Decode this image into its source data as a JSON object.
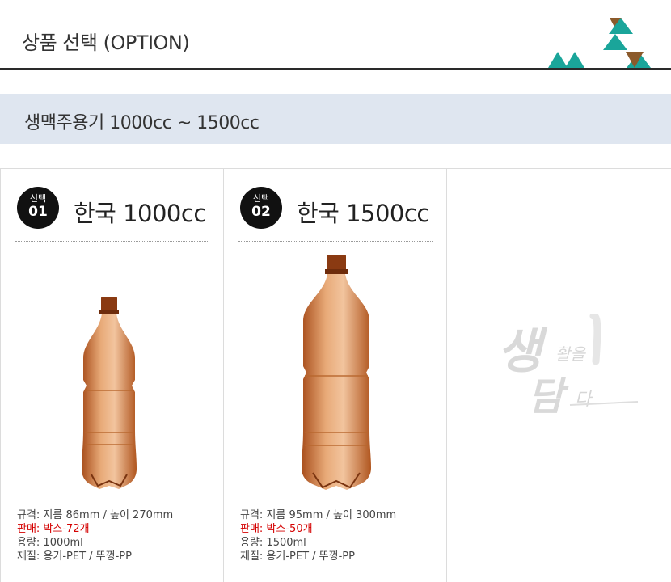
{
  "header": {
    "title": "상품 선택 (OPTION)"
  },
  "subbar": {
    "title": "생맥주용기 1000cc ~ 1500cc"
  },
  "options": [
    {
      "badge_label": "선택",
      "badge_number": "01",
      "title": "한국 1000cc",
      "spec_size": "규격: 지름 86mm / 높이 270mm",
      "spec_sale": "판매: 박스-72개",
      "spec_volume": "용량: 1000ml",
      "spec_material": "재질: 용기-PET / 뚜껑-PP"
    },
    {
      "badge_label": "선택",
      "badge_number": "02",
      "title": "한국 1500cc",
      "spec_size": "규격: 지름 95mm / 높이 300mm",
      "spec_sale": "판매: 박스-50개",
      "spec_volume": "용량: 1500ml",
      "spec_material": "재질: 용기-PET / 뚜껑-PP"
    }
  ],
  "watermark": {
    "line1_big": "생",
    "line1_small": "활을",
    "line2_big": "담",
    "line2_small": "다"
  },
  "colors": {
    "accent_teal": "#1aa59a",
    "accent_brown": "#8b5a2b",
    "header_rule": "#2a2a2a",
    "subbar_bg": "#dfe6f0",
    "sale_red": "#d40000",
    "bottle_amber": "#c0632a"
  }
}
